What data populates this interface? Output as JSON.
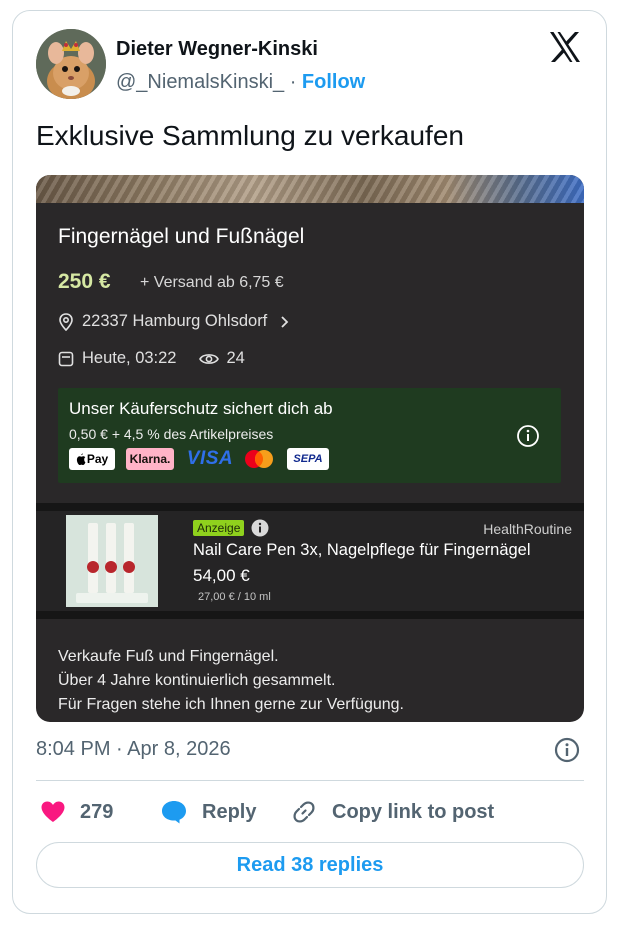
{
  "author": {
    "name": "Dieter Wegner-Kinski",
    "handle": "@_NiemalsKinski_",
    "separator": " · ",
    "follow_label": "Follow"
  },
  "tweet": {
    "text": "Exklusive Sammlung zu verkaufen",
    "timestamp": "8:04 PM · Apr 8, 2026"
  },
  "listing": {
    "title": "Fingernägel und Fußnägel",
    "price": "250 €",
    "shipping": "+ Versand ab 6,75 €",
    "location": "22337 Hamburg Ohlsdorf",
    "posted": "Heute, 03:22",
    "views": "24",
    "protection": {
      "title": "Unser Käuferschutz sichert dich ab",
      "fee": "0,50 € + 4,5 % des Artikelpreises",
      "methods": [
        "Pay",
        "Klarna.",
        "VISA",
        "SEPA"
      ]
    },
    "ad": {
      "badge": "Anzeige",
      "brand": "HealthRoutine",
      "title": "Nail Care Pen 3x, Nagelpflege für Fingernägel",
      "price": "54,00 €",
      "unit_price": "27,00 € / 10 ml"
    },
    "description": [
      "Verkaufe Fuß und Fingernägel.",
      "Über 4 Jahre kontinuierlich gesammelt.",
      "Für Fragen stehe ich Ihnen gerne zur Verfügung."
    ]
  },
  "actions": {
    "likes": "279",
    "reply_label": "Reply",
    "copy_label": "Copy link to post",
    "read_replies_label": "Read 38 replies"
  },
  "colors": {
    "accent": "#1d9bf0",
    "like": "#f91880",
    "price_green": "#d6e8a3"
  },
  "icons": [
    "x-logo-icon",
    "location-pin-icon",
    "calendar-icon",
    "eye-icon",
    "info-icon",
    "heart-icon",
    "reply-bubble-icon",
    "link-icon"
  ]
}
